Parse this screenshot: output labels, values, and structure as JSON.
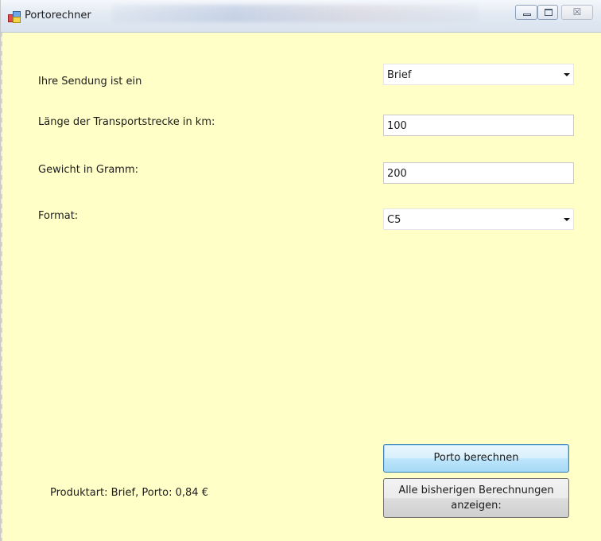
{
  "window": {
    "title": "Portorechner",
    "icons": {
      "app": "app-icon",
      "minimize": "minimize-icon",
      "maximize": "maximize-icon",
      "close": "close-icon"
    },
    "close_glyph": "☒"
  },
  "form": {
    "sendung_label": "Ihre Sendung ist ein",
    "sendung_value": "Brief",
    "strecke_label": "Länge der Transportstrecke in km:",
    "strecke_value": "100",
    "gewicht_label": "Gewicht in Gramm:",
    "gewicht_value": "200",
    "format_label": "Format:",
    "format_value": "C5"
  },
  "actions": {
    "berechnen_label": "Porto berechnen",
    "alle_label_line1": "Alle bisherigen Berechnungen",
    "alle_label_line2": "anzeigen:"
  },
  "result_text": "Produktart: Brief, Porto: 0,84 €",
  "colors": {
    "window_background": "#ffffc7",
    "primary_button": "#bee6fd",
    "primary_border": "#3c7fb1"
  }
}
